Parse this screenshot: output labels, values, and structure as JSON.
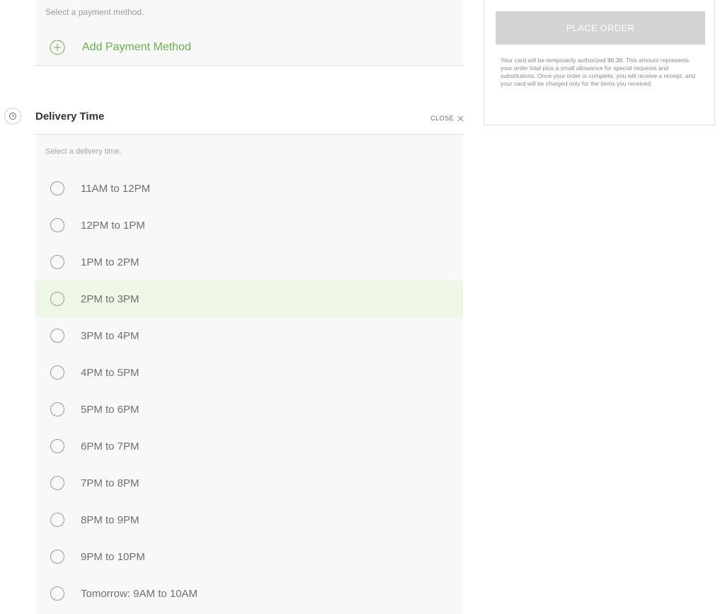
{
  "payment": {
    "hint": "Select a payment method.",
    "add_label": "Add Payment Method"
  },
  "delivery": {
    "title": "Delivery Time",
    "close_label": "CLOSE",
    "hint": "Select a delivery time.",
    "slots": [
      "11AM to 12PM",
      "12PM to 1PM",
      "1PM to 2PM",
      "2PM to 3PM",
      "3PM to 4PM",
      "4PM to 5PM",
      "5PM to 6PM",
      "6PM to 7PM",
      "7PM to 8PM",
      "8PM to 9PM",
      "9PM to 10PM",
      "Tomorrow: 9AM to 10AM"
    ],
    "highlighted_slot": "2PM to 3PM"
  },
  "order": {
    "place_label": "PLACE ORDER",
    "note": "Your card will be temporarily authorized $6.38. This amount represents your order total plus a small allowance for special requests and substitutions. Once your order is complete, you will receive a receipt, and your card will be charged only for the items you received."
  },
  "colors": {
    "accent_green": "#6ab04c",
    "highlight_bg": "#eef6e6",
    "disabled_button": "#d3d3d3"
  }
}
